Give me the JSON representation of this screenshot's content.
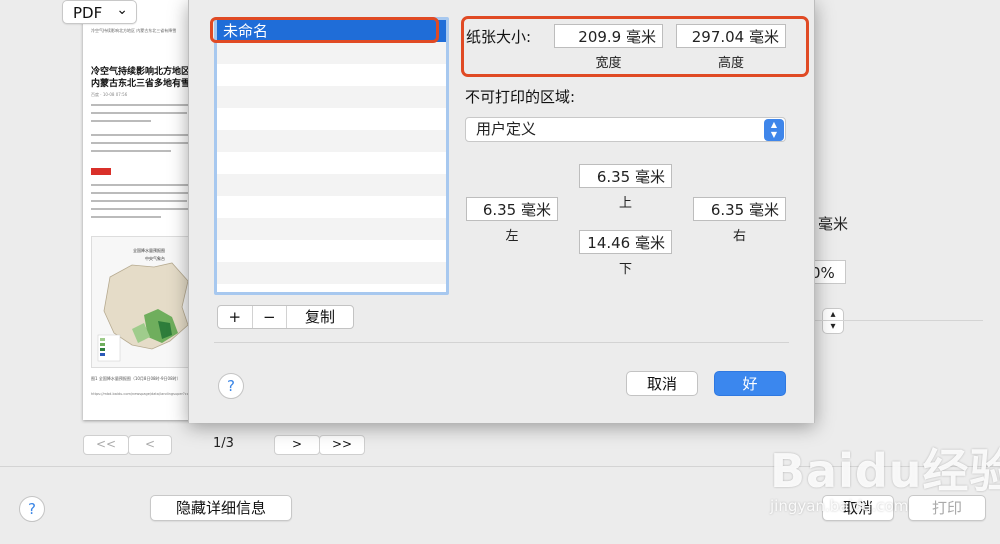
{
  "preview": {
    "header": "冷空气持续影响北方地区 内蒙古东北三省有降雪",
    "title": "冷空气持续影响北方地区 内蒙古东北三省多地有雪",
    "meta": "百度 · 10-08 07:56",
    "map_title": "全国降水量预报图",
    "map_org": "中央气象台",
    "caption": "图1 全国降水量预报图（10月8日08时-9日08时）",
    "url": "https://mbd.baidu.com/newspage/data/landingsuper?context=",
    "page_indicator": "1/3",
    "nav": {
      "first": "<<",
      "prev": "<",
      "next": ">",
      "last": ">>"
    }
  },
  "background": {
    "unit_fragment": "毫米",
    "scale_fragment": "0%",
    "pdf_button": "PDF",
    "pdf_chevron": "⌄",
    "hide_details_button": "隐藏详细信息",
    "cancel_button": "取消",
    "print_button": "打印",
    "help": "?"
  },
  "sheet": {
    "paper_list": {
      "selected": "未命名"
    },
    "list_controls": {
      "add": "+",
      "remove": "−",
      "duplicate": "复制"
    },
    "paper_size": {
      "label": "纸张大小:",
      "width_value": "209.9 毫米",
      "width_label": "宽度",
      "height_value": "297.04 毫米",
      "height_label": "高度"
    },
    "non_printable": {
      "label": "不可打印的区域:",
      "popup_value": "用户定义",
      "top_value": "6.35 毫米",
      "top_label": "上",
      "left_value": "6.35 毫米",
      "left_label": "左",
      "right_value": "6.35 毫米",
      "right_label": "右",
      "bottom_value": "14.46 毫米",
      "bottom_label": "下"
    },
    "help": "?",
    "cancel_button": "取消",
    "ok_button": "好"
  },
  "watermark": {
    "main": "Baidu经验",
    "sub": "jingyan.baidu.com"
  },
  "colors": {
    "accent": "#3b87ee",
    "highlight_outline": "#e04a24",
    "selection": "#1f6dd8"
  },
  "icons": {
    "popup_arrows": "up-down-chevron-icon"
  }
}
